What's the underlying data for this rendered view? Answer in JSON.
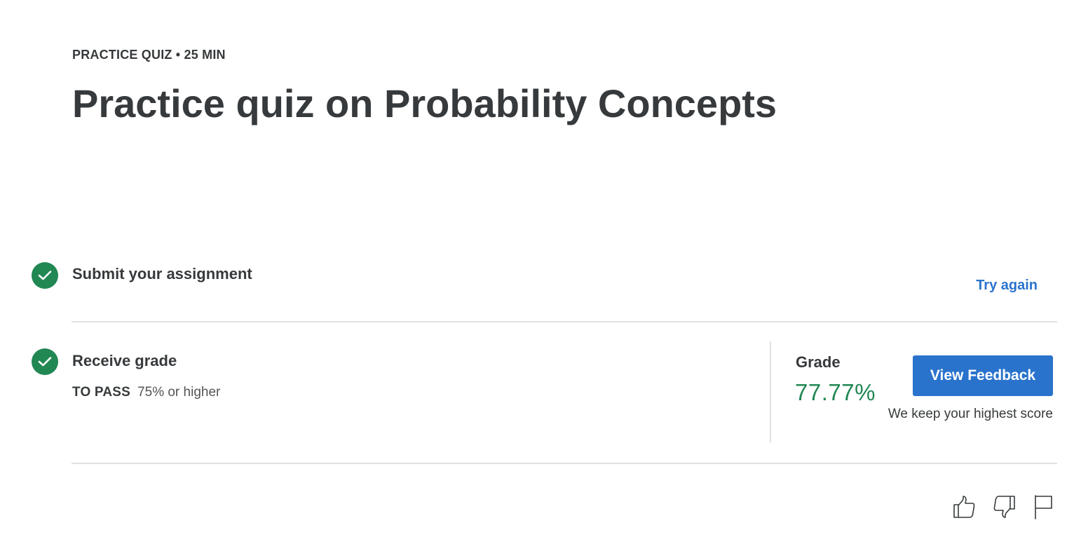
{
  "header": {
    "eyebrow": "PRACTICE QUIZ • 25 MIN",
    "title": "Practice quiz on Probability Concepts"
  },
  "steps": {
    "submit": {
      "label": "Submit your assignment",
      "action_label": "Try again",
      "status_icon": "check-circle-icon"
    },
    "receive": {
      "label": "Receive grade",
      "pass_key": "TO PASS",
      "pass_value": "75% or higher",
      "status_icon": "check-circle-icon"
    }
  },
  "grade": {
    "label": "Grade",
    "value": "77.77%",
    "button_label": "View Feedback",
    "note": "We keep your highest score"
  },
  "feedback_icons": [
    "thumbs-up-icon",
    "thumbs-down-icon",
    "flag-icon"
  ],
  "colors": {
    "success": "#218753",
    "accent": "#2a73cc",
    "text": "#373a3c",
    "divider": "#e1e1e1"
  }
}
